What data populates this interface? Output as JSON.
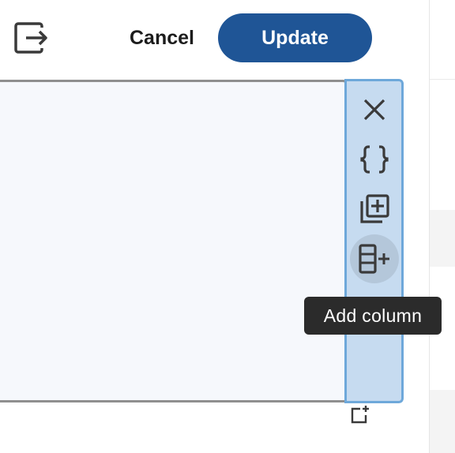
{
  "header": {
    "exit_icon": "exit-arrow-icon",
    "cancel_label": "Cancel",
    "update_label": "Update"
  },
  "toolbar": {
    "buttons": [
      {
        "icon": "close-icon"
      },
      {
        "icon": "braces-icon"
      },
      {
        "icon": "add-library-icon"
      },
      {
        "icon": "add-column-icon",
        "hovered": true
      }
    ]
  },
  "tooltip": {
    "text": "Add column"
  },
  "corner": {
    "icon": "add-box-corner-icon"
  },
  "colors": {
    "primary": "#1f5596",
    "toolbar_bg": "#c6dbf0",
    "toolbar_border": "#6ea8da",
    "tooltip_bg": "#2b2b2b"
  }
}
